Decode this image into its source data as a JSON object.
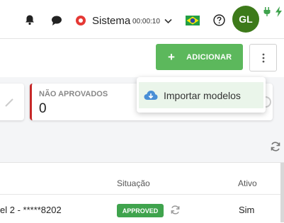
{
  "topbar": {
    "status_label": "Sistema",
    "timer": "00:00:10",
    "avatar_initials": "GL",
    "avatar_color": "#3d7a1a"
  },
  "actions": {
    "add_label": "ADICIONAR",
    "add_color": "#5cb85c"
  },
  "dropdown": {
    "items": [
      {
        "label": "Importar modelos",
        "icon": "cloud-download-icon"
      }
    ]
  },
  "cards": {
    "not_approved_title": "NÃO APROVADOS",
    "not_approved_value": "0",
    "accent": "#c62828"
  },
  "table": {
    "headers": {
      "status": "Situação",
      "active": "Ativo"
    },
    "rows": [
      {
        "name": "el 2 - *****8202",
        "status": "APPROVED",
        "active": "Sim"
      }
    ]
  }
}
